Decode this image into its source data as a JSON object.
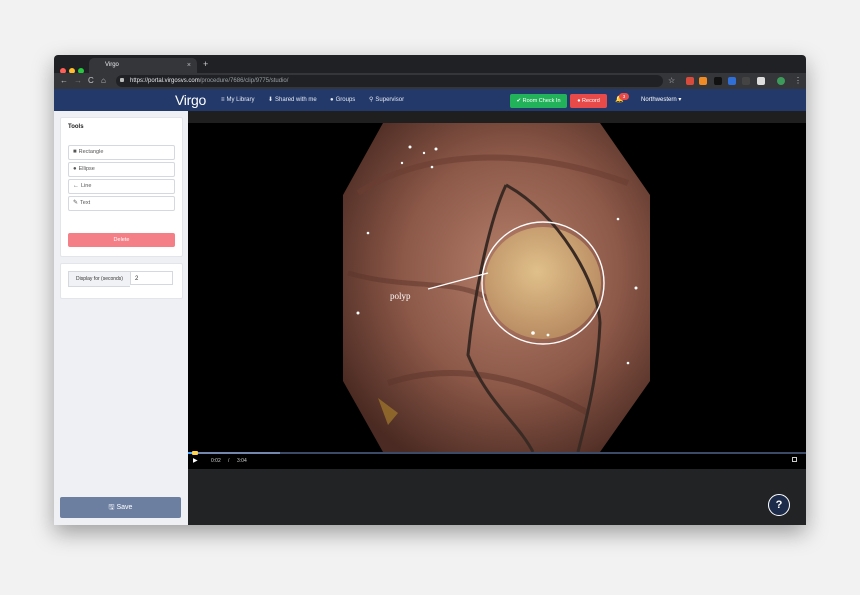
{
  "browser": {
    "tab_title": "Virgo",
    "tab_close": "×",
    "new_tab": "+",
    "back_icon": "←",
    "forward_icon": "→",
    "reload_icon": "C",
    "home_icon": "⌂",
    "url_host": "https://portal.virgosvs.com",
    "url_path": "/procedure/7686/clip/9775/studio/",
    "star_icon": "☆",
    "menu_icon": "⋮"
  },
  "navbar": {
    "logo": "Virgo",
    "links": [
      {
        "icon": "≡",
        "label": "My Library"
      },
      {
        "icon": "⬇",
        "label": "Shared with me"
      },
      {
        "icon": "●",
        "label": "Groups"
      },
      {
        "icon": "⚲",
        "label": "Supervisor"
      }
    ],
    "checkin_label": "✔ Room Check In",
    "record_label": "● Record",
    "notification_count": "3",
    "org_label": "Northwestern ▾",
    "colors": {
      "bar": "#23396a",
      "checkin": "#22b35a",
      "record": "#e84a4a"
    }
  },
  "sidebar": {
    "tools_title": "Tools",
    "tools": [
      {
        "icon": "■",
        "label": "Rectangle"
      },
      {
        "icon": "●",
        "label": "Ellipse"
      },
      {
        "icon": "←",
        "label": "Line"
      },
      {
        "icon": "✎",
        "label": "Text"
      }
    ],
    "delete_label": "Delete",
    "display_label": "Display for (seconds)",
    "display_value": "2",
    "save_label": "Save",
    "save_icon": "🖫"
  },
  "video": {
    "annotation_text": "polyp",
    "current_time": "0:02",
    "separator": "/",
    "duration": "3:04",
    "progress": 0.011,
    "play_icon": "▶",
    "help_label": "?"
  }
}
